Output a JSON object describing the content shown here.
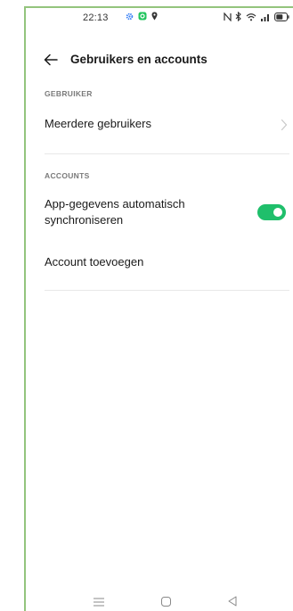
{
  "status_bar": {
    "time": "22:13",
    "app_icons": [
      "settings-gear-icon",
      "green-app-icon",
      "location-icon"
    ],
    "system_icons": [
      "nfc-icon",
      "bluetooth-icon",
      "wifi-icon",
      "signal-icon",
      "battery-icon"
    ]
  },
  "header": {
    "title": "Gebruikers en accounts"
  },
  "sections": {
    "user": {
      "header": "GEBRUIKER",
      "items": [
        {
          "label": "Meerdere gebruikers"
        }
      ]
    },
    "accounts": {
      "header": "ACCOUNTS",
      "items": [
        {
          "label_line1": "App-gegevens automatisch",
          "label_line2": "synchroniseren",
          "toggle_on": true
        },
        {
          "label": "Account toevoegen"
        }
      ]
    }
  },
  "colors": {
    "accent": "#1fbf6b",
    "frame": "#93c47d"
  },
  "nav_bar": {
    "icons": [
      "menu-icon",
      "home-icon",
      "back-triangle-icon"
    ]
  }
}
